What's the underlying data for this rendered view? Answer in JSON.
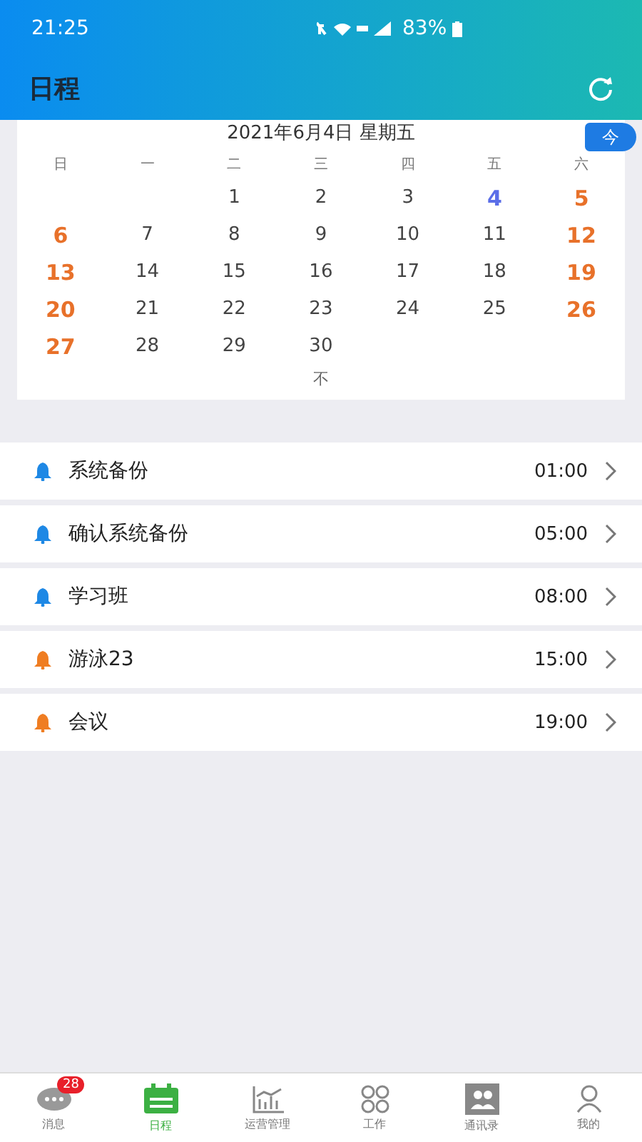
{
  "status_bar": {
    "time": "21:25",
    "battery": "83%"
  },
  "header": {
    "title": "日程"
  },
  "calendar": {
    "date_title": "2021年6月4日 星期五",
    "today_button": "今",
    "weekdays": [
      "日",
      "一",
      "二",
      "三",
      "四",
      "五",
      "六"
    ],
    "weeks": [
      {
        "kind": "first",
        "days": [
          {
            "day": "1",
            "kind": "weekday"
          },
          {
            "day": "2",
            "kind": "weekday"
          },
          {
            "day": "3",
            "kind": "weekday"
          },
          {
            "day": "4",
            "kind": "today"
          },
          {
            "day": "5",
            "kind": "weekend"
          }
        ]
      },
      {
        "kind": "regular",
        "days": [
          {
            "day": "6",
            "kind": "weekend"
          },
          {
            "day": "7",
            "kind": "weekday"
          },
          {
            "day": "8",
            "kind": "weekday"
          },
          {
            "day": "9",
            "kind": "weekday"
          },
          {
            "day": "10",
            "kind": "weekday"
          },
          {
            "day": "11",
            "kind": "weekday"
          },
          {
            "day": "12",
            "kind": "weekend"
          }
        ]
      },
      {
        "kind": "regular",
        "days": [
          {
            "day": "13",
            "kind": "weekend"
          },
          {
            "day": "14",
            "kind": "weekday"
          },
          {
            "day": "15",
            "kind": "weekday"
          },
          {
            "day": "16",
            "kind": "weekday"
          },
          {
            "day": "17",
            "kind": "weekday"
          },
          {
            "day": "18",
            "kind": "weekday"
          },
          {
            "day": "19",
            "kind": "weekend"
          }
        ]
      },
      {
        "kind": "regular",
        "days": [
          {
            "day": "20",
            "kind": "weekend"
          },
          {
            "day": "21",
            "kind": "weekday"
          },
          {
            "day": "22",
            "kind": "weekday"
          },
          {
            "day": "23",
            "kind": "weekday"
          },
          {
            "day": "24",
            "kind": "weekday"
          },
          {
            "day": "25",
            "kind": "weekday"
          },
          {
            "day": "26",
            "kind": "weekend"
          }
        ]
      },
      {
        "kind": "regular",
        "days": [
          {
            "day": "27",
            "kind": "weekend"
          },
          {
            "day": "28",
            "kind": "weekday"
          },
          {
            "day": "29",
            "kind": "weekday"
          },
          {
            "day": "30",
            "kind": "weekday"
          }
        ]
      }
    ],
    "collapse_toggle": "不"
  },
  "events": [
    {
      "title": "系统备份",
      "time": "01:00",
      "color": "#1e88e5"
    },
    {
      "title": "确认系统备份",
      "time": "05:00",
      "color": "#1e88e5"
    },
    {
      "title": "学习班",
      "time": "08:00",
      "color": "#1e88e5"
    },
    {
      "title": "游泳23",
      "time": "15:00",
      "color": "#ef7d22"
    },
    {
      "title": "会议",
      "time": "19:00",
      "color": "#ef7d22"
    }
  ],
  "tab_bar": [
    {
      "label": "消息",
      "selected": false,
      "badge": "28"
    },
    {
      "label": "日程",
      "selected": true
    },
    {
      "label": "运营管理",
      "selected": false
    },
    {
      "label": "工作",
      "selected": false
    },
    {
      "label": "通讯录",
      "selected": false
    },
    {
      "label": "我的",
      "selected": false
    }
  ]
}
